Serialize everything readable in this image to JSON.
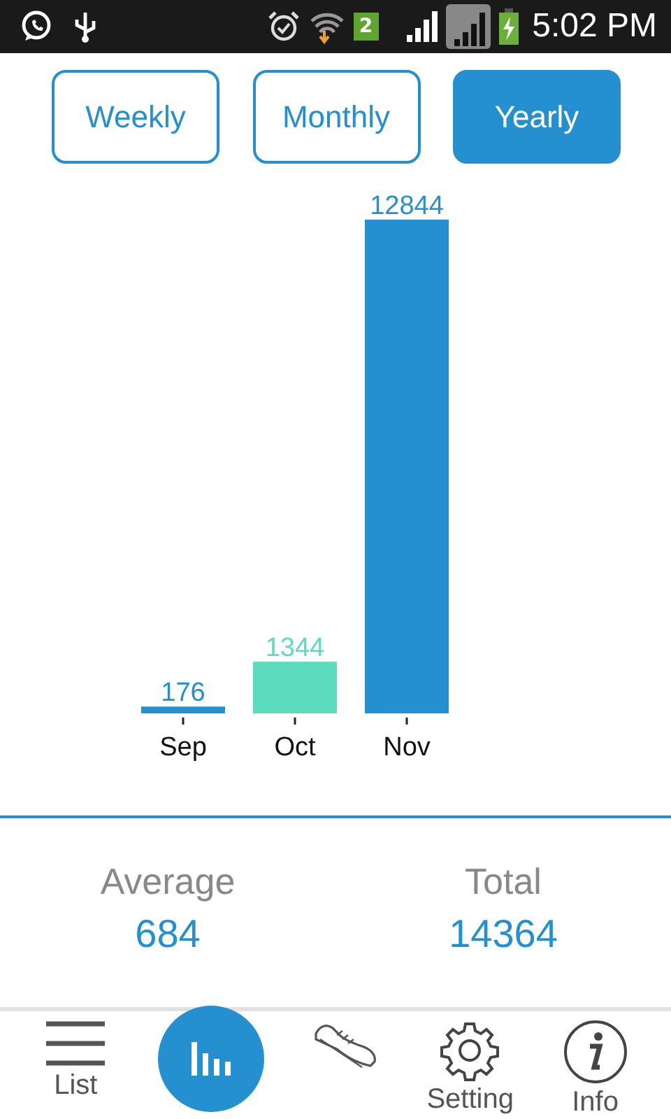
{
  "status_bar": {
    "sim_badge": "2",
    "time": "5:02 PM"
  },
  "tabs": [
    {
      "label": "Weekly",
      "selected": false
    },
    {
      "label": "Monthly",
      "selected": false
    },
    {
      "label": "Yearly",
      "selected": true
    }
  ],
  "chart": {
    "chart_data": {
      "type": "bar",
      "categories": [
        "Sep",
        "Oct",
        "Nov"
      ],
      "series": [
        {
          "color": "#2490d0",
          "values": [
            176,
            null,
            12844
          ]
        },
        {
          "color": "#5cdcbf",
          "values": [
            null,
            1344,
            null
          ]
        }
      ],
      "stacked": true,
      "data_labels": true
    }
  },
  "stats": [
    {
      "label": "Average",
      "value": "684"
    },
    {
      "label": "Total",
      "value": "14364"
    }
  ],
  "bottom_nav": [
    {
      "kind": "menu",
      "label": "List",
      "selected": false
    },
    {
      "kind": "chart",
      "selected": true
    },
    {
      "kind": "shoe",
      "selected": false
    },
    {
      "kind": "settings",
      "label": "Setting",
      "selected": false
    },
    {
      "kind": "info",
      "label": "Info",
      "selected": false
    }
  ]
}
